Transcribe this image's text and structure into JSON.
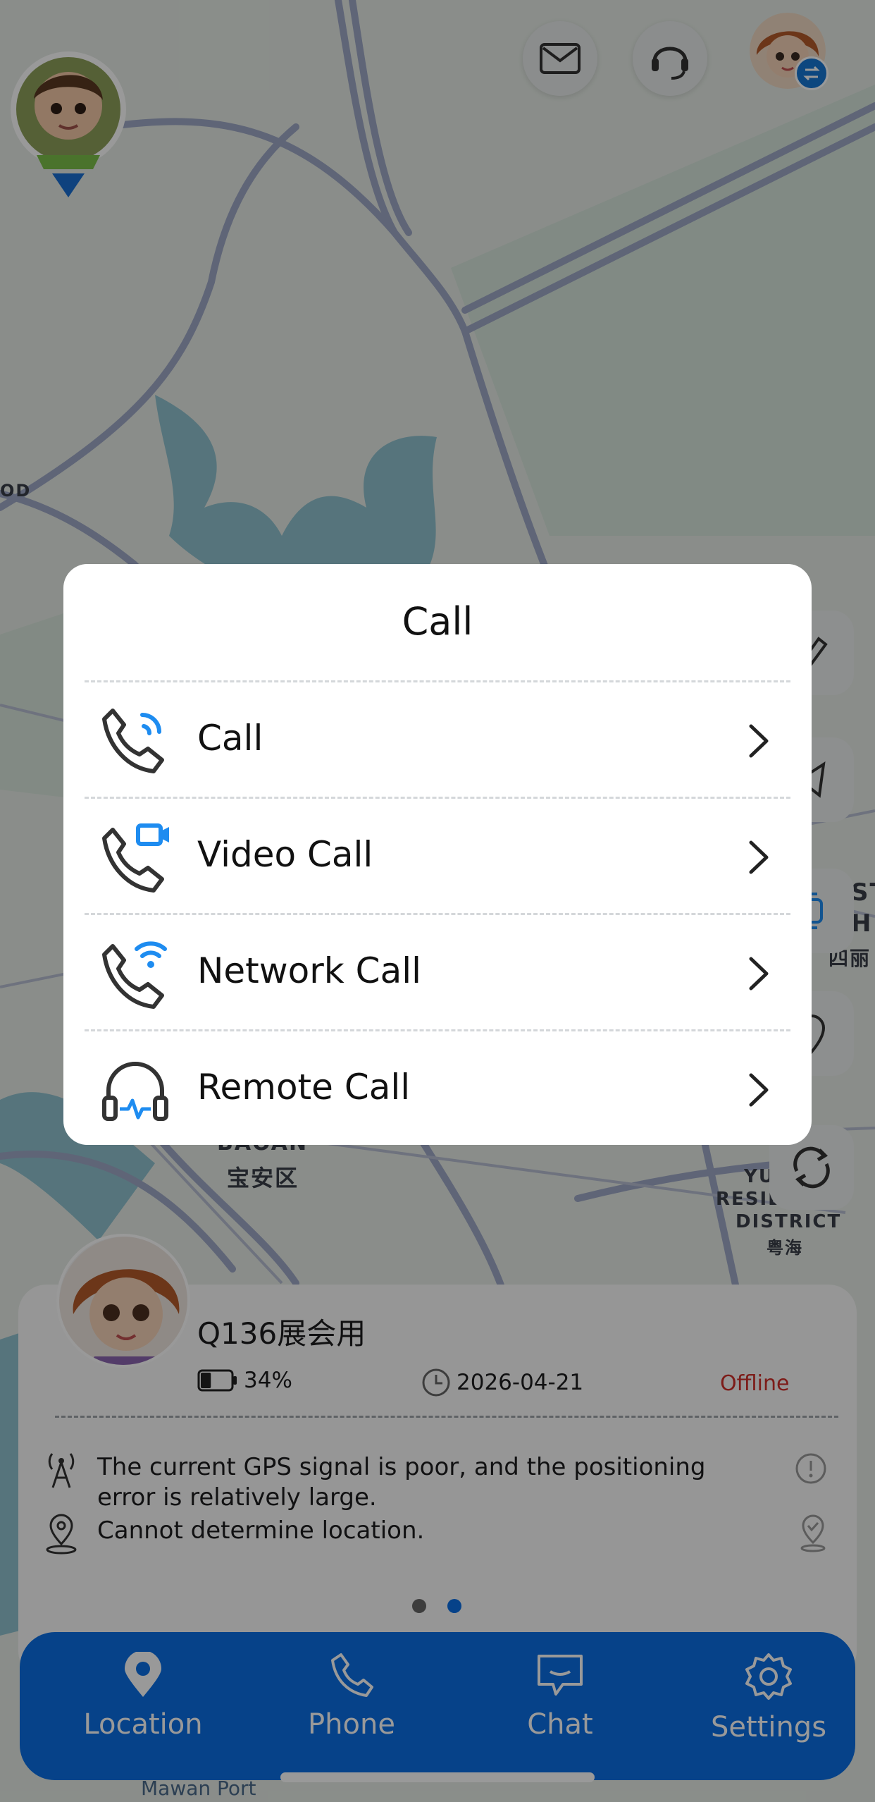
{
  "map": {
    "district_en": "BAOAN",
    "district_cn": "宝安区",
    "right_district_en": "DISTRICT",
    "right_district_line": "YU",
    "right_district_resil": "RESIL",
    "right_district_cn": "粤海",
    "port_label": "Mawan Port",
    "edge_label_od": "OD",
    "edge_label_st": "ST",
    "edge_label_h": "H",
    "edge_label_cn": "四丽"
  },
  "modal": {
    "title": "Call",
    "options": [
      {
        "label": "Call",
        "icon": "phone-waves-icon"
      },
      {
        "label": "Video Call",
        "icon": "phone-video-icon"
      },
      {
        "label": "Network Call",
        "icon": "phone-wifi-icon"
      },
      {
        "label": "Remote Call",
        "icon": "headphones-pulse-icon"
      }
    ]
  },
  "device": {
    "name": "Q136展会用",
    "battery": "34%",
    "battery_level": 0.34,
    "date": "2026-04-21",
    "status": "Offline",
    "gps_message": "The current GPS signal is poor, and the positioning error is relatively large.",
    "location_message": "Cannot determine location.",
    "page_dots": {
      "count": 2,
      "active": 1
    }
  },
  "tabs": [
    {
      "label": "Location",
      "icon": "location-pin-icon"
    },
    {
      "label": "Phone",
      "icon": "phone-icon"
    },
    {
      "label": "Chat",
      "icon": "chat-bubble-icon"
    },
    {
      "label": "Settings",
      "icon": "gear-icon"
    }
  ],
  "colors": {
    "accent": "#0a6fe4",
    "offline": "#d0302a",
    "icon_blue": "#1e8cf0"
  }
}
